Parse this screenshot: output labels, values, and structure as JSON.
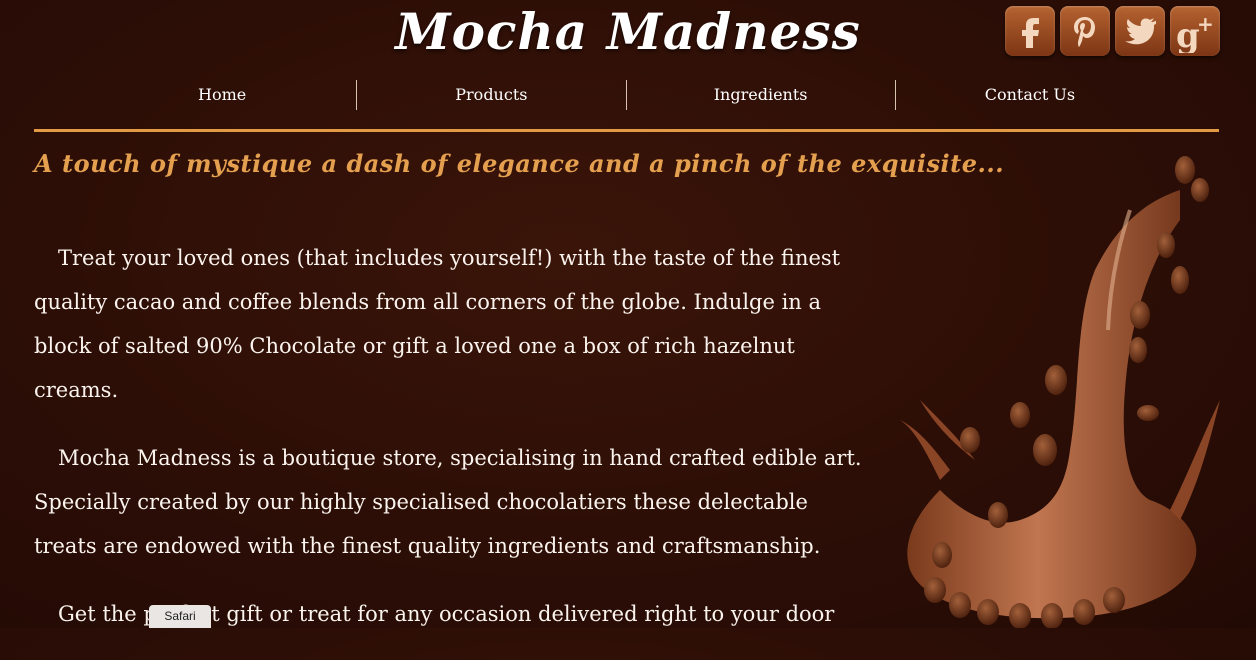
{
  "header": {
    "title": "Mocha Madness"
  },
  "social": [
    {
      "icon": "facebook-icon",
      "glyph": "f"
    },
    {
      "icon": "pinterest-icon",
      "glyph": "P"
    },
    {
      "icon": "twitter-icon",
      "glyph": "t"
    },
    {
      "icon": "google-plus-icon",
      "glyph": "g+"
    }
  ],
  "nav": {
    "items": [
      {
        "label": "Home"
      },
      {
        "label": "Products"
      },
      {
        "label": "Ingredients"
      },
      {
        "label": "Contact Us"
      }
    ]
  },
  "tagline": "A touch of mystique a dash of elegance and a pinch of the exquisite...",
  "content": {
    "paragraphs": [
      "Treat your loved ones (that includes yourself!) with the taste of the finest quality cacao and coffee blends from all corners of the globe. Indulge in a block of salted 90% Chocolate or gift a loved one a box of rich hazelnut creams.",
      "Mocha Madness is a boutique store, specialising in hand crafted edible art. Specially created by our highly specialised chocolatiers these delectable treats are endowed with the finest quality ingredients and craftsmanship.",
      "Get the perfect gift or treat for any occasion delivered right to your door"
    ]
  },
  "browser": {
    "tab_label": "Safari"
  },
  "colors": {
    "accent": "#e39a44",
    "background": "#2c0e06",
    "social_button": "#9a4a20"
  }
}
